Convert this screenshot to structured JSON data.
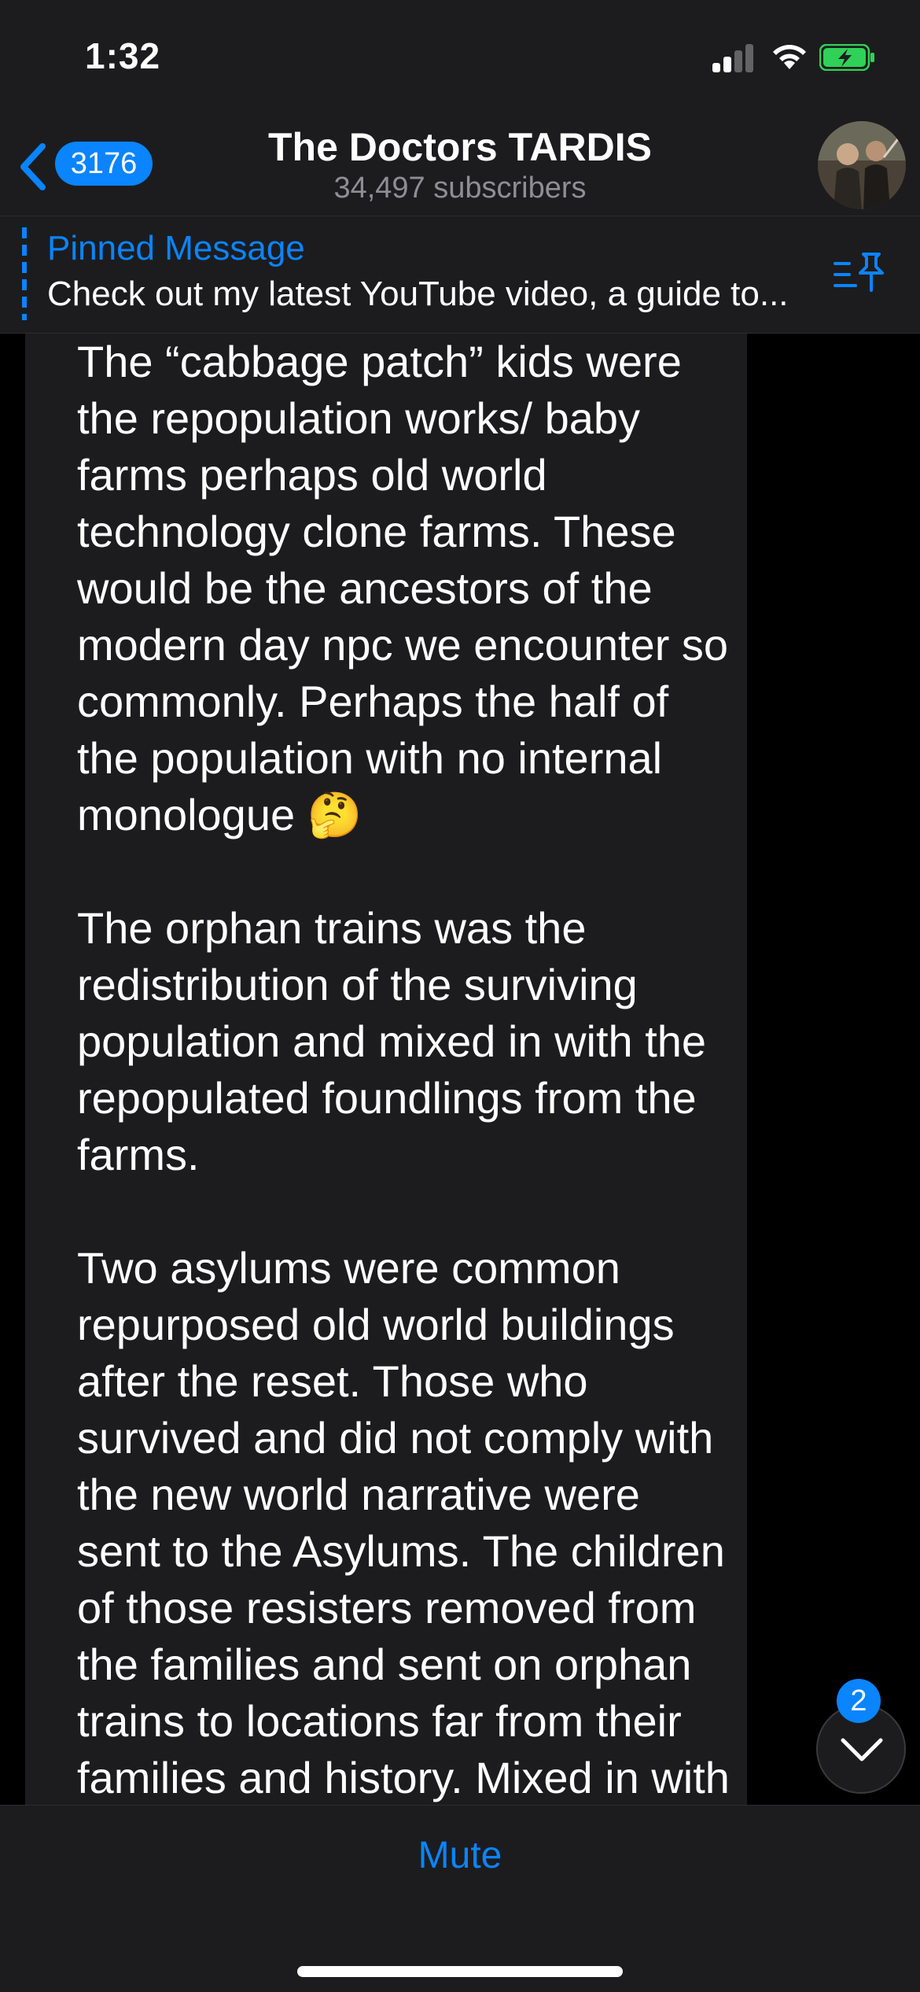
{
  "status_bar": {
    "time": "1:32"
  },
  "header": {
    "back_count": "3176",
    "title": "The Doctors TARDIS",
    "subtitle": "34,497 subscribers"
  },
  "pinned": {
    "title": "Pinned Message",
    "text": "Check out my latest YouTube video, a guide to..."
  },
  "message": {
    "text": "The “cabbage patch” kids were\nthe repopulation works/ baby\nfarms perhaps old world\ntechnology clone farms. These\nwould be the ancestors of the\nmodern day npc we encounter so\ncommonly. Perhaps the half of\nthe population with no internal\nmonologue 🤔\n\nThe orphan trains was the\nredistribution of the surviving\npopulation and mixed in with the\nrepopulated foundlings from the\nfarms.\n\nTwo asylums were common\nrepurposed old world buildings\nafter the reset. Those who\nsurvived and did not comply with\nthe new world narrative were\nsent to the Asylums. The children\nof those resisters removed from\nthe families and sent on orphan\ntrains to locations far from their\nfamilies and history. Mixed in with"
  },
  "scroll_button": {
    "unread": "2"
  },
  "bottom": {
    "mute_label": "Mute"
  },
  "icons": {
    "back": "chevron-left-icon",
    "pin": "pinned-list-icon",
    "scroll": "chevron-down-icon",
    "signal": "cellular-signal-icon",
    "wifi": "wifi-icon",
    "battery": "battery-charging-icon"
  },
  "colors": {
    "accent": "#0a84ff",
    "bar_background": "#1c1c1e",
    "chat_background": "#000000",
    "battery": "#30d158"
  }
}
